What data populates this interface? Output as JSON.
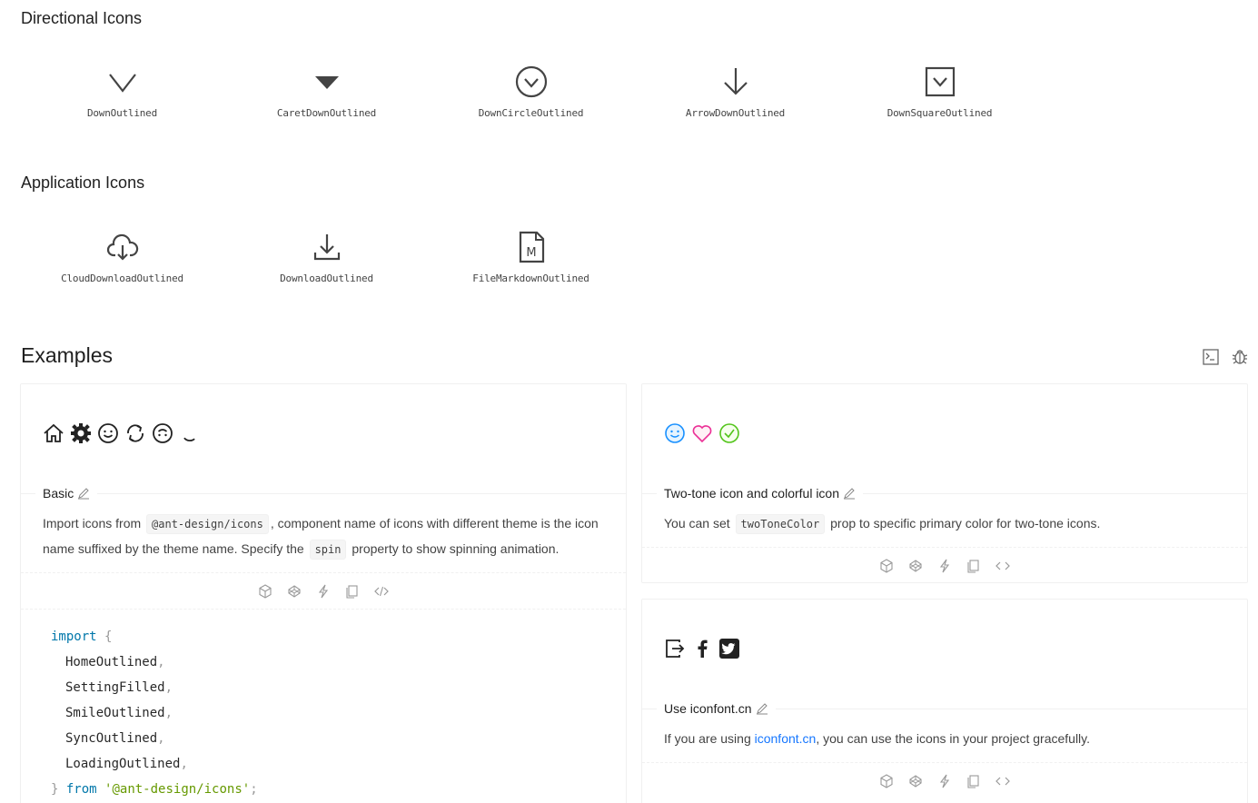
{
  "sections": {
    "directional": {
      "title": "Directional Icons",
      "icons": [
        "DownOutlined",
        "CaretDownOutlined",
        "DownCircleOutlined",
        "ArrowDownOutlined",
        "DownSquareOutlined"
      ]
    },
    "application": {
      "title": "Application Icons",
      "icons": [
        "CloudDownloadOutlined",
        "DownloadOutlined",
        "FileMarkdownOutlined"
      ]
    }
  },
  "examples": {
    "title": "Examples",
    "basic": {
      "title": "Basic",
      "desc_1": "Import icons from",
      "code_1": "@ant-design/icons",
      "desc_2": ", component name of icons with different theme is the icon name suffixed by the theme name. Specify the",
      "code_2": "spin",
      "desc_3": "property to show spinning animation.",
      "code_lines": {
        "import": "import",
        "brace_open": "{",
        "items": [
          "HomeOutlined",
          "SettingFilled",
          "SmileOutlined",
          "SyncOutlined",
          "LoadingOutlined"
        ],
        "brace_close": "}",
        "from": "from",
        "module": "'@ant-design/icons'",
        "semi": ";"
      }
    },
    "twotone": {
      "title": "Two-tone icon and colorful icon",
      "desc_1": "You can set",
      "code_1": "twoToneColor",
      "desc_2": "prop to specific primary color for two-tone icons."
    },
    "iconfont": {
      "title": "Use iconfont.cn",
      "desc_1": "If you are using",
      "link": "iconfont.cn",
      "desc_2": ", you can use the icons in your project gracefully."
    }
  },
  "colors": {
    "twotone_blue": "#1890ff",
    "twotone_pink": "#eb2f96",
    "twotone_green": "#52c41a",
    "link": "#1677ff"
  }
}
